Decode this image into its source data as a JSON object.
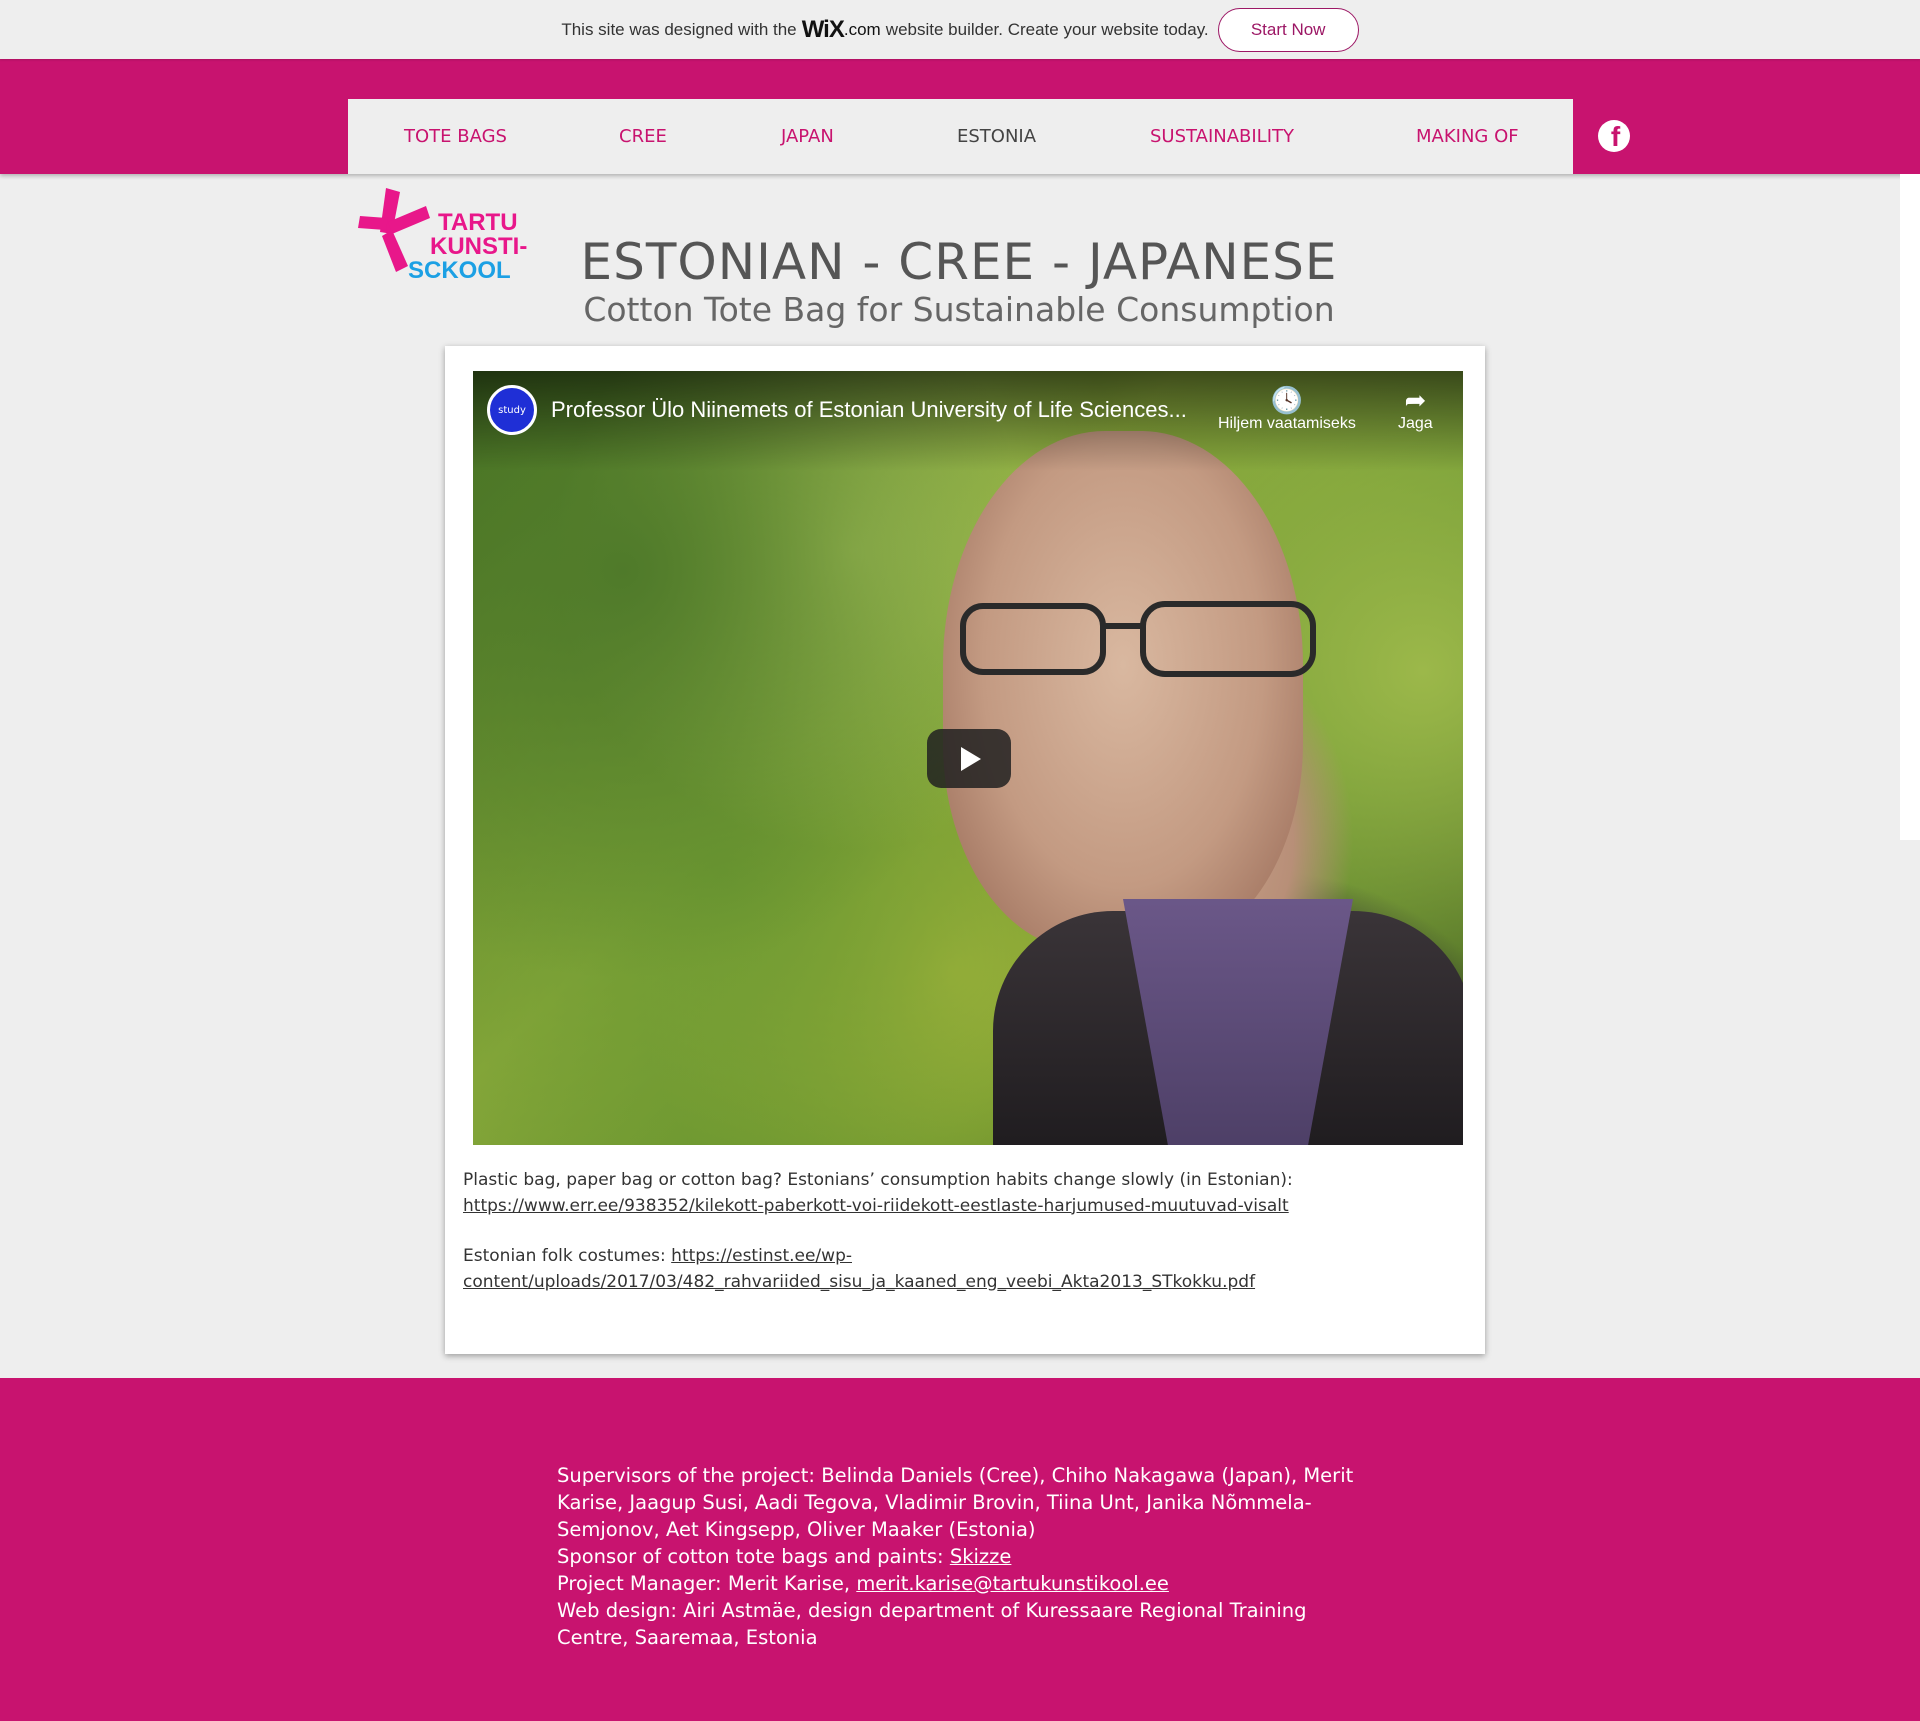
{
  "banner": {
    "text_before": "This site was designed with the",
    "logo": "WiX",
    "logo_suffix": ".com",
    "text_after": "website builder. Create your website today.",
    "start_button": "Start Now"
  },
  "nav": {
    "items": [
      {
        "label": "TOTE BAGS"
      },
      {
        "label": "CREE"
      },
      {
        "label": "JAPAN"
      },
      {
        "label": "ESTONIA"
      },
      {
        "label": "SUSTAINABILITY"
      },
      {
        "label": "MAKING OF"
      }
    ],
    "active": "ESTONIA",
    "social_icon": "facebook-icon"
  },
  "logo": {
    "line1": "TARTU",
    "line2": "KUNSTI-",
    "line3": "SCKOOL"
  },
  "header": {
    "title": "ESTONIAN - CREE - JAPANESE",
    "subtitle": "Cotton Tote Bag for Sustainable Consumption"
  },
  "video": {
    "title": "Professor Ülo Niinemets of Estonian University of Life Sciences...",
    "watch_later": "Hiljem vaatamiseks",
    "share": "Jaga",
    "channel_icon": "study-in-estonia-icon"
  },
  "content": {
    "p1_text": "Plastic bag, paper bag or cotton bag? Estonians’ consumption habits change slowly (in Estonian):",
    "p1_link": "https://www.err.ee/938352/kilekott-paberkott-voi-riidekott-eestlaste-harjumused-muutuvad-visalt",
    "p2_text": "Estonian folk costumes:",
    "p2_link_a": "https://estinst.ee/wp-",
    "p2_link_b": "content/uploads/2017/03/482_rahvariided_sisu_ja_kaaned_eng_veebi_Akta2013_STkokku.pdf"
  },
  "footer": {
    "supervisors": "Supervisors of the project: Belinda Daniels (Cree), Chiho Nakagawa (Japan), Merit Karise, Jaagup Susi, Aadi Tegova, Vladimir Brovin, Tiina Unt, Janika Nõmmela-Semjonov, Aet Kingsepp, Oliver Maaker (Estonia)",
    "sponsor_label": "Sponsor of cotton tote bags and paints:",
    "sponsor_link": "Skizze",
    "pm_label": "Project Manager: Merit Karise,",
    "pm_email": "merit.karise@tartukunstikool.ee",
    "webdesign": "Web design: Airi Astmäe, design department of Kuressaare Regional Training Centre, Saaremaa, Estonia"
  },
  "colors": {
    "brand_magenta": "#c8136f",
    "nav_background": "#eeeeee",
    "page_background": "#eeeeee"
  }
}
